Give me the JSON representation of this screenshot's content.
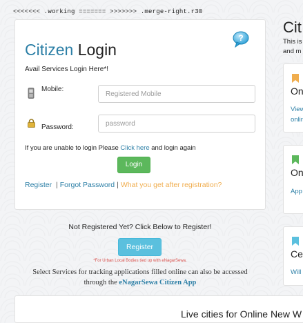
{
  "merge_marker": "<<<<<<< .working ======= >>>>>>> .merge-right.r30",
  "login": {
    "title_part1": "Citizen",
    "title_part2": " Login",
    "subtitle": "Avail Services Login Here*!",
    "mobile_label": "Mobile:",
    "mobile_placeholder": "Registered Mobile",
    "password_label": "Password:",
    "password_placeholder": "password",
    "help_prefix": "If you are unable to login Please ",
    "help_link": "Click here",
    "help_suffix": " and login again",
    "login_button": "Login",
    "register_link": "Register",
    "forgot_link": "Forgot Password",
    "after_registration_link": "What you get after registration?",
    "sep1": "|",
    "sep2": "|"
  },
  "registration": {
    "not_registered": "Not Registered Yet? Click Below to Register!",
    "register_button": "Register",
    "ulb_note": "*For Urban Local Bodies tied up with eNagarSewa.",
    "select_services_line1": "Select Services for tracking applications filled online can also be accessed",
    "select_services_prefix": "through the ",
    "select_services_app": "eNagarSewa Citizen App"
  },
  "bottom": {
    "title": "Live cities for Online New W"
  },
  "right_panel": {
    "heading": "Cit",
    "sub1": "This is",
    "sub2": "and m",
    "cards": [
      {
        "title": "On",
        "link1": "View",
        "link2": "onlin",
        "color": "#f0ad4e"
      },
      {
        "title": "On",
        "link1": "App",
        "color": "#5cb85c"
      },
      {
        "title": "Ce",
        "link1": "Will",
        "color": "#5bc0de"
      }
    ]
  },
  "colors": {
    "brand_blue": "#2c7fa6",
    "login_green": "#5cb85c",
    "register_cyan": "#5bc0de",
    "link_orange": "#f0ad4e",
    "note_red": "#d9534f"
  },
  "icons": {
    "help": "speech-bubble-question-icon",
    "mobile": "mobile-phone-icon",
    "password": "padlock-icon"
  }
}
